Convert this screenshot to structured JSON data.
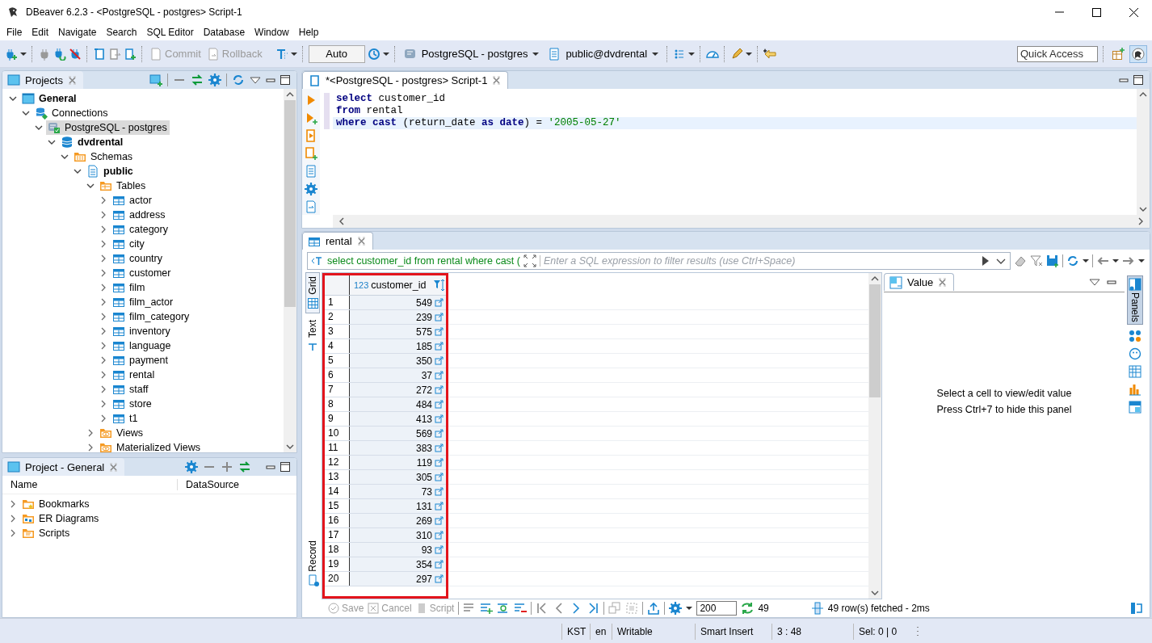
{
  "window": {
    "title": "DBeaver 6.2.3 - <PostgreSQL - postgres> Script-1"
  },
  "menu": [
    "File",
    "Edit",
    "Navigate",
    "Search",
    "SQL Editor",
    "Database",
    "Window",
    "Help"
  ],
  "toolbar": {
    "commit": {
      "label": "Commit",
      "disabled": true
    },
    "rollback": {
      "label": "Rollback",
      "disabled": true
    },
    "transaction_mode": "Auto",
    "connection": "PostgreSQL - postgres",
    "schema": "public@dvdrental",
    "quick_access": {
      "placeholder": "Quick Access"
    }
  },
  "projects": {
    "tab": "Projects",
    "tree": [
      {
        "label": "General",
        "kind": "project",
        "bold": true,
        "expanded": true,
        "selected": false,
        "children": [
          {
            "label": "Connections",
            "kind": "connections",
            "bold": false,
            "expanded": true,
            "selected": false,
            "children": [
              {
                "label": "PostgreSQL - postgres",
                "kind": "connection",
                "bold": false,
                "expanded": true,
                "selected": true,
                "children": [
                  {
                    "label": "dvdrental",
                    "kind": "database",
                    "bold": true,
                    "expanded": true,
                    "selected": false,
                    "children": [
                      {
                        "label": "Schemas",
                        "kind": "schemas",
                        "bold": false,
                        "expanded": true,
                        "selected": false,
                        "children": [
                          {
                            "label": "public",
                            "kind": "schema",
                            "bold": true,
                            "expanded": true,
                            "selected": false,
                            "children": [
                              {
                                "label": "Tables",
                                "kind": "tables",
                                "bold": false,
                                "expanded": true,
                                "selected": false,
                                "children": [
                                  {
                                    "label": "actor",
                                    "kind": "table",
                                    "bold": false,
                                    "expanded": false,
                                    "selected": false
                                  },
                                  {
                                    "label": "address",
                                    "kind": "table",
                                    "bold": false,
                                    "expanded": false,
                                    "selected": false
                                  },
                                  {
                                    "label": "category",
                                    "kind": "table",
                                    "bold": false,
                                    "expanded": false,
                                    "selected": false
                                  },
                                  {
                                    "label": "city",
                                    "kind": "table",
                                    "bold": false,
                                    "expanded": false,
                                    "selected": false
                                  },
                                  {
                                    "label": "country",
                                    "kind": "table",
                                    "bold": false,
                                    "expanded": false,
                                    "selected": false
                                  },
                                  {
                                    "label": "customer",
                                    "kind": "table",
                                    "bold": false,
                                    "expanded": false,
                                    "selected": false
                                  },
                                  {
                                    "label": "film",
                                    "kind": "table",
                                    "bold": false,
                                    "expanded": false,
                                    "selected": false
                                  },
                                  {
                                    "label": "film_actor",
                                    "kind": "table",
                                    "bold": false,
                                    "expanded": false,
                                    "selected": false
                                  },
                                  {
                                    "label": "film_category",
                                    "kind": "table",
                                    "bold": false,
                                    "expanded": false,
                                    "selected": false
                                  },
                                  {
                                    "label": "inventory",
                                    "kind": "table",
                                    "bold": false,
                                    "expanded": false,
                                    "selected": false
                                  },
                                  {
                                    "label": "language",
                                    "kind": "table",
                                    "bold": false,
                                    "expanded": false,
                                    "selected": false
                                  },
                                  {
                                    "label": "payment",
                                    "kind": "table",
                                    "bold": false,
                                    "expanded": false,
                                    "selected": false
                                  },
                                  {
                                    "label": "rental",
                                    "kind": "table",
                                    "bold": false,
                                    "expanded": false,
                                    "selected": false
                                  },
                                  {
                                    "label": "staff",
                                    "kind": "table",
                                    "bold": false,
                                    "expanded": false,
                                    "selected": false
                                  },
                                  {
                                    "label": "store",
                                    "kind": "table",
                                    "bold": false,
                                    "expanded": false,
                                    "selected": false
                                  },
                                  {
                                    "label": "t1",
                                    "kind": "table",
                                    "bold": false,
                                    "expanded": false,
                                    "selected": false
                                  }
                                ]
                              },
                              {
                                "label": "Views",
                                "kind": "views",
                                "bold": false,
                                "expanded": false,
                                "selected": false
                              },
                              {
                                "label": "Materialized Views",
                                "kind": "views",
                                "bold": false,
                                "expanded": false,
                                "selected": false
                              }
                            ]
                          }
                        ]
                      }
                    ]
                  }
                ]
              }
            ]
          }
        ]
      }
    ]
  },
  "project_general": {
    "tab": "Project - General",
    "columns": [
      "Name",
      "DataSource"
    ],
    "items": [
      {
        "label": "Bookmarks",
        "kind": "bookmarks",
        "expanded": false
      },
      {
        "label": "ER Diagrams",
        "kind": "diagrams",
        "expanded": false
      },
      {
        "label": "Scripts",
        "kind": "scripts",
        "expanded": false
      }
    ]
  },
  "editor": {
    "tab": {
      "label": "*<PostgreSQL - postgres> Script-1",
      "selected": true
    },
    "lines": [
      {
        "current": false,
        "tokens": [
          {
            "kind": "keyword",
            "text": "select"
          },
          {
            "kind": "plain",
            "text": " customer_id"
          }
        ]
      },
      {
        "current": false,
        "tokens": [
          {
            "kind": "keyword",
            "text": "from"
          },
          {
            "kind": "plain",
            "text": " rental"
          }
        ]
      },
      {
        "current": true,
        "tokens": [
          {
            "kind": "keyword",
            "text": "where"
          },
          {
            "kind": "keyword",
            "text": " cast"
          },
          {
            "kind": "plain",
            "text": " (return_date "
          },
          {
            "kind": "keyword",
            "text": "as"
          },
          {
            "kind": "keyword",
            "text": " date"
          },
          {
            "kind": "plain",
            "text": ") = "
          },
          {
            "kind": "string",
            "text": "'2005-05-27'"
          }
        ]
      }
    ]
  },
  "results": {
    "tab": "rental",
    "active_query": "select customer_id from rental where cast (",
    "filter": {
      "placeholder": "Enter a SQL expression to filter results (use Ctrl+Space)"
    },
    "views": [
      {
        "label": "Grid",
        "selected": true
      },
      {
        "label": "Text",
        "selected": false
      },
      {
        "label": "Record",
        "selected": false
      }
    ],
    "column": {
      "type": "123",
      "name": "customer_id",
      "highlighted": true
    },
    "rows": [
      {
        "num": "1",
        "customer_id": "549"
      },
      {
        "num": "2",
        "customer_id": "239"
      },
      {
        "num": "3",
        "customer_id": "575"
      },
      {
        "num": "4",
        "customer_id": "185"
      },
      {
        "num": "5",
        "customer_id": "350"
      },
      {
        "num": "6",
        "customer_id": "37"
      },
      {
        "num": "7",
        "customer_id": "272"
      },
      {
        "num": "8",
        "customer_id": "484"
      },
      {
        "num": "9",
        "customer_id": "413"
      },
      {
        "num": "10",
        "customer_id": "569"
      },
      {
        "num": "11",
        "customer_id": "383"
      },
      {
        "num": "12",
        "customer_id": "119"
      },
      {
        "num": "13",
        "customer_id": "305"
      },
      {
        "num": "14",
        "customer_id": "73"
      },
      {
        "num": "15",
        "customer_id": "131"
      },
      {
        "num": "16",
        "customer_id": "269"
      },
      {
        "num": "17",
        "customer_id": "310"
      },
      {
        "num": "18",
        "customer_id": "93"
      },
      {
        "num": "19",
        "customer_id": "354"
      },
      {
        "num": "20",
        "customer_id": "297"
      }
    ],
    "value_panel": {
      "tab": "Value",
      "message": [
        "Select a cell to view/edit value",
        "Press Ctrl+7 to hide this panel"
      ]
    },
    "panels_button": "Panels",
    "actions": [
      {
        "label": "Save",
        "disabled": true
      },
      {
        "label": "Cancel",
        "disabled": true
      },
      {
        "label": "Script",
        "disabled": true
      }
    ],
    "fetch_size": {
      "value": "200"
    },
    "row_count": "49",
    "fetch_info": "49 row(s) fetched - 2ms"
  },
  "status_bar": [
    "KST",
    "en",
    "Writable",
    "Smart Insert",
    "3 : 48",
    "Sel: 0 | 0"
  ]
}
